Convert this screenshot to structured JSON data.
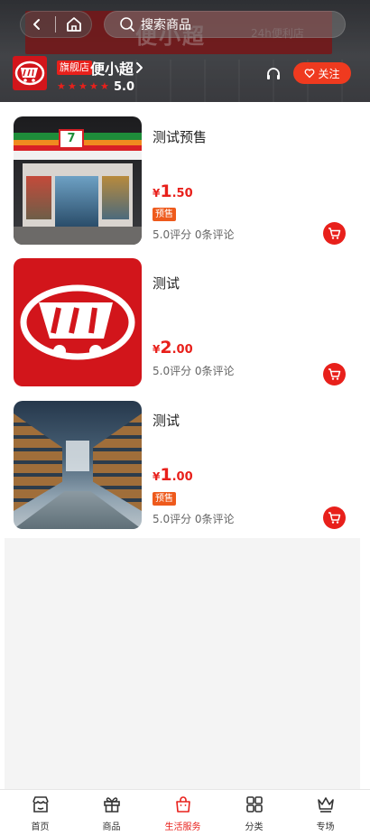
{
  "header": {
    "search_placeholder": "搜索商品",
    "sign_text": "便小超",
    "sign_subtext": "24h便利店",
    "store_badge": "旗舰店",
    "store_name": "便小超",
    "stars": 5,
    "rating": "5.0",
    "follow_label": "关注",
    "colors": {
      "accent": "#e8201b",
      "follow": "#ef3a1f"
    },
    "icons": [
      "back-icon",
      "home-icon",
      "search-icon",
      "chevron-right-icon",
      "headset-icon",
      "heart-icon"
    ]
  },
  "products": [
    {
      "title": "测试预售",
      "currency": "¥",
      "price_int": "1",
      "price_dec": ".50",
      "tag": "预售",
      "meta": "5.0评分 0条评论",
      "image": "7-eleven-storefront"
    },
    {
      "title": "测试",
      "currency": "¥",
      "price_int": "2",
      "price_dec": ".00",
      "tag": "",
      "meta": "5.0评分 0条评论",
      "image": "red-store-logo"
    },
    {
      "title": "测试",
      "currency": "¥",
      "price_int": "1",
      "price_dec": ".00",
      "tag": "预售",
      "meta": "5.0评分 0条评论",
      "image": "warehouse-shelves"
    }
  ],
  "tabbar": {
    "active": "生活服务",
    "items": [
      {
        "label": "首页",
        "icon": "store-icon"
      },
      {
        "label": "商品",
        "icon": "gift-icon"
      },
      {
        "label": "生活服务",
        "icon": "shopping-bag-icon"
      },
      {
        "label": "分类",
        "icon": "grid-icon"
      },
      {
        "label": "专场",
        "icon": "crown-icon"
      }
    ]
  }
}
